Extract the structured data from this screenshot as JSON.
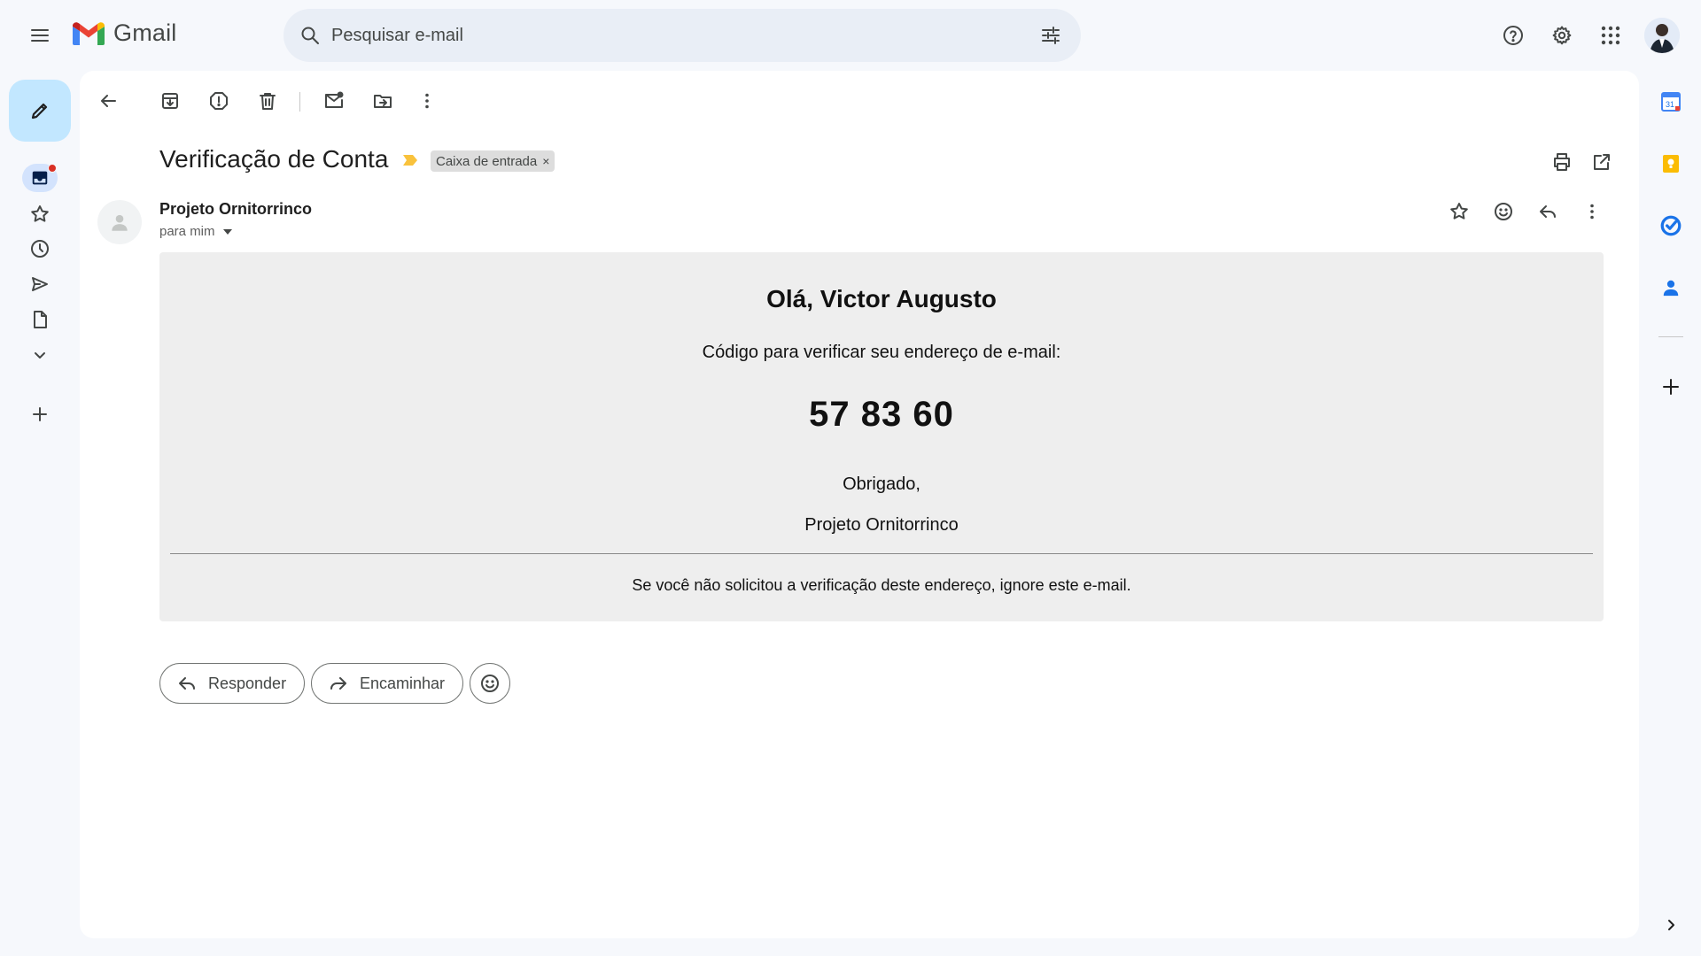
{
  "app": {
    "name": "Gmail"
  },
  "search": {
    "placeholder": "Pesquisar e-mail",
    "value": ""
  },
  "email": {
    "subject": "Verificação de Conta",
    "label": "Caixa de entrada",
    "label_remove": "×",
    "sender": "Projeto Ornitorrinco",
    "recipient": "para mim",
    "body": {
      "greeting": "Olá, Victor Augusto",
      "instruction": "Código para verificar seu endereço de e-mail:",
      "code": "57 83 60",
      "thanks": "Obrigado,",
      "signature": "Projeto Ornitorrinco",
      "footer": "Se você não solicitou a verificação deste endereço, ignore este e-mail."
    }
  },
  "actions": {
    "reply_label": "Responder",
    "forward_label": "Encaminhar"
  },
  "icons": {
    "header": [
      "menu-icon",
      "gmail-logo-icon",
      "search-icon",
      "tune-icon",
      "help-icon",
      "settings-icon",
      "apps-icon",
      "avatar"
    ],
    "rail": [
      "pencil-icon",
      "inbox-icon",
      "star-icon",
      "clock-icon",
      "send-icon",
      "draft-icon",
      "chevron-down-icon",
      "plus-icon"
    ],
    "toolbar": [
      "back-arrow-icon",
      "archive-icon",
      "report-spam-icon",
      "trash-icon",
      "mark-unread-icon",
      "move-to-icon",
      "more-vert-icon"
    ],
    "side": [
      "calendar-icon",
      "keep-icon",
      "tasks-icon",
      "contacts-icon",
      "plus-icon",
      "chevron-right-icon"
    ]
  },
  "colors": {
    "background": "#f6f8fc",
    "compose": "#c2e7ff",
    "search_bg": "#e9eef6",
    "email_body_bg": "#eeeeee",
    "unread_dot": "#d93025",
    "important_marker": "#f9c23c"
  },
  "calendar_day": "31"
}
